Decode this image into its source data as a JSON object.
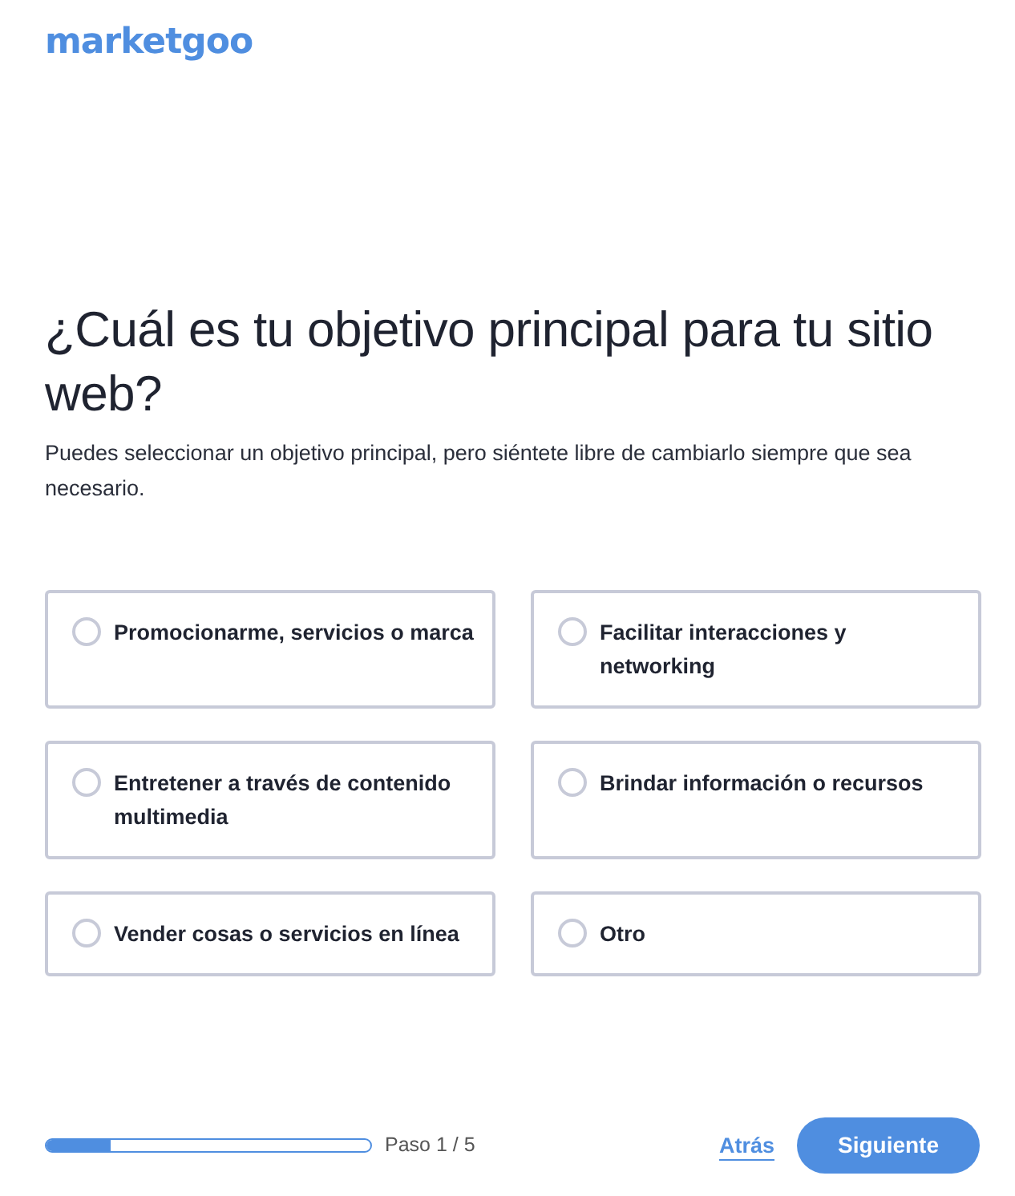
{
  "logo": "marketgoo",
  "title": "¿Cuál es tu objetivo principal para tu sitio web?",
  "subtitle": "Puedes seleccionar un objetivo principal, pero siéntete libre de cambiarlo siempre que sea necesario.",
  "options": [
    {
      "label": "Promocionarme, servicios o marca",
      "selected": false
    },
    {
      "label": "Facilitar interacciones y networking",
      "selected": false
    },
    {
      "label": "Entretener a través de contenido multimedia",
      "selected": false
    },
    {
      "label": "Brindar información o recursos",
      "selected": false
    },
    {
      "label": "Vender cosas o servicios en línea",
      "selected": false
    },
    {
      "label": "Otro",
      "selected": false
    }
  ],
  "progress": {
    "level": 0.2,
    "label": "Paso 1 / 5"
  },
  "back_link": "Atrás",
  "next_button": "Siguiente"
}
